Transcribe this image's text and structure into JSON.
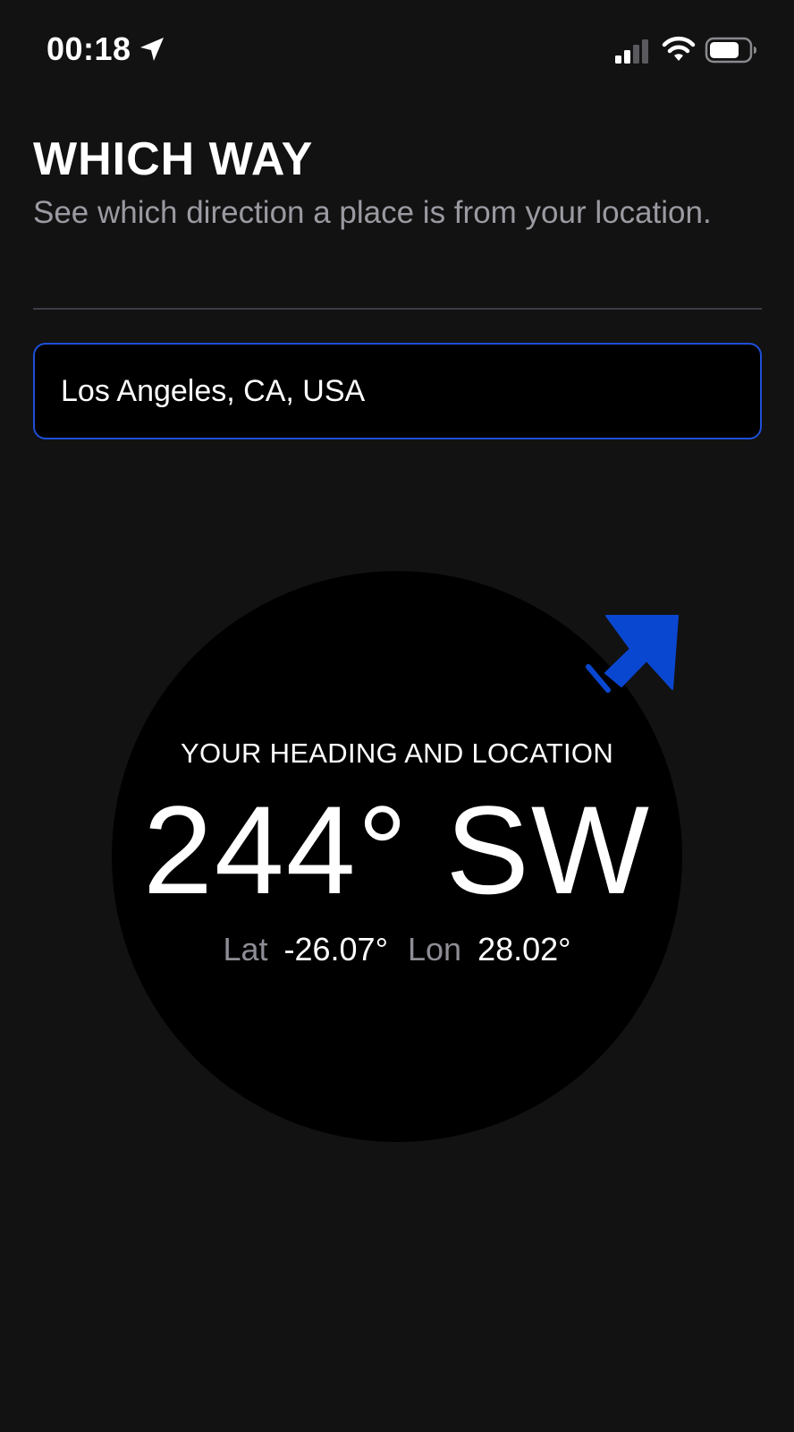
{
  "status_bar": {
    "time": "00:18",
    "location_icon": "location-arrow-icon",
    "signal_icon": "cellular-signal-icon",
    "wifi_icon": "wifi-icon",
    "battery_icon": "battery-icon"
  },
  "header": {
    "title": "WHICH WAY",
    "subtitle": "See which direction a place is from your location."
  },
  "search": {
    "value": "Los Angeles, CA, USA"
  },
  "compass": {
    "caption": "YOUR HEADING AND LOCATION",
    "heading": "244° SW",
    "lat_label": "Lat",
    "lat_value": "-26.07°",
    "lon_label": "Lon",
    "lon_value": "28.02°",
    "arrow_icon": "direction-arrow-icon"
  },
  "colors": {
    "background": "#121212",
    "dial": "#000000",
    "accent": "#0a47d1",
    "input_border": "#1e4fd8",
    "muted_text": "#9a9aa2"
  }
}
